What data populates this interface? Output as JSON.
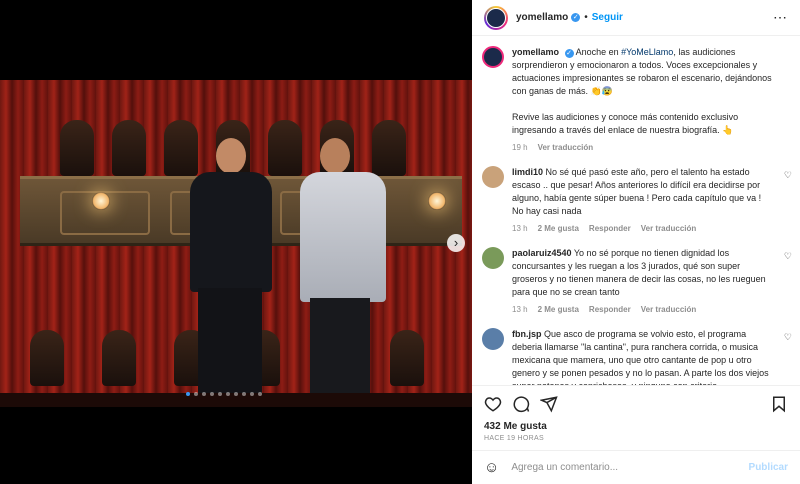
{
  "post": {
    "username": "yomellamo",
    "follow_label": "Seguir",
    "more_icon": "⋯",
    "caption_pre": "Anoche en ",
    "caption_tag": "#YoMeLlamo",
    "caption_post": ", las audiciones sorprendieron y emocionaron a todos. Voces excepcionales y actuaciones impresionantes se robaron el escenario, dejándonos con ganas de más. 👏😰",
    "caption_2": "Revive las audiciones y conoce más contenido exclusivo ingresando a través del enlace de nuestra biografía. 👆",
    "caption_time": "19 h",
    "caption_translate": "Ver traducción"
  },
  "comments": [
    {
      "user": "limdi10",
      "text": "No sé qué pasó este año, pero el talento ha estado escaso .. que pesar! Años anteriores lo difícil era decidirse por alguno, había gente súper buena ! Pero cada capítulo que va ! No hay casi nada",
      "time": "13 h",
      "likes": "2 Me gusta",
      "reply": "Responder",
      "translate": "Ver traducción",
      "avatar_color": "#c9a27a"
    },
    {
      "user": "paolaruiz4540",
      "text": "Yo no sé porque no tienen dignidad los concursantes y les ruegan a los 3 jurados, qué son super groseros y no tienen manera de decir las cosas, no les rueguen para que no se crean tanto",
      "time": "13 h",
      "likes": "2 Me gusta",
      "reply": "Responder",
      "translate": "Ver traducción",
      "avatar_color": "#7a9a5a"
    },
    {
      "user": "fbn.jsp",
      "text": "Que asco de programa se volvio esto, el programa deberia llamarse \"la cantina\", pura ranchera corrida, o musica mexicana que mamera, uno que otro cantante de pop u otro genero y se ponen pesados y no lo pasan. A parte los dos viejos super patanes y caprichosos, y ninguno con criterio",
      "time": "",
      "likes": "",
      "reply": "",
      "translate": "",
      "avatar_color": "#5a7ea8"
    }
  ],
  "footer": {
    "likes": "432 Me gusta",
    "ago": "HACE 19 HORAS",
    "comment_placeholder": "Agrega un comentario...",
    "publish_label": "Publicar"
  },
  "carousel": {
    "total_slides": 10,
    "current_slide": 1
  },
  "colors": {
    "accent": "#0095f6",
    "verified": "#3897f0"
  }
}
